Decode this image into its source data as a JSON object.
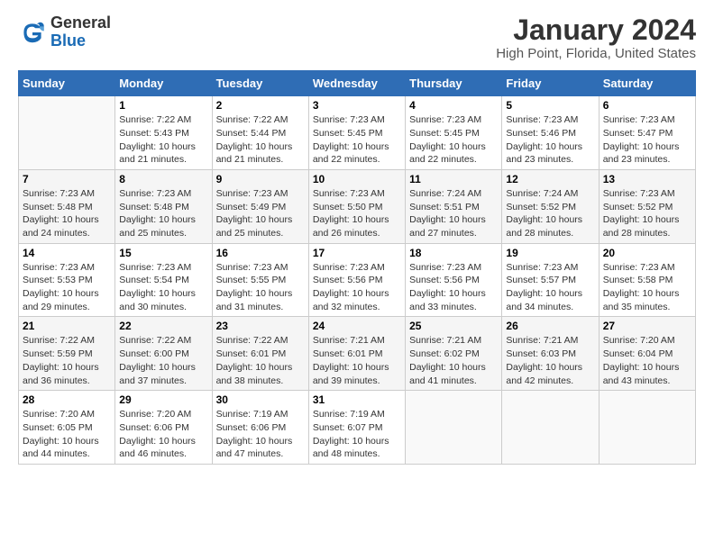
{
  "logo": {
    "general": "General",
    "blue": "Blue"
  },
  "title": "January 2024",
  "subtitle": "High Point, Florida, United States",
  "headers": [
    "Sunday",
    "Monday",
    "Tuesday",
    "Wednesday",
    "Thursday",
    "Friday",
    "Saturday"
  ],
  "weeks": [
    [
      {
        "num": "",
        "info": ""
      },
      {
        "num": "1",
        "info": "Sunrise: 7:22 AM\nSunset: 5:43 PM\nDaylight: 10 hours\nand 21 minutes."
      },
      {
        "num": "2",
        "info": "Sunrise: 7:22 AM\nSunset: 5:44 PM\nDaylight: 10 hours\nand 21 minutes."
      },
      {
        "num": "3",
        "info": "Sunrise: 7:23 AM\nSunset: 5:45 PM\nDaylight: 10 hours\nand 22 minutes."
      },
      {
        "num": "4",
        "info": "Sunrise: 7:23 AM\nSunset: 5:45 PM\nDaylight: 10 hours\nand 22 minutes."
      },
      {
        "num": "5",
        "info": "Sunrise: 7:23 AM\nSunset: 5:46 PM\nDaylight: 10 hours\nand 23 minutes."
      },
      {
        "num": "6",
        "info": "Sunrise: 7:23 AM\nSunset: 5:47 PM\nDaylight: 10 hours\nand 23 minutes."
      }
    ],
    [
      {
        "num": "7",
        "info": "Sunrise: 7:23 AM\nSunset: 5:48 PM\nDaylight: 10 hours\nand 24 minutes."
      },
      {
        "num": "8",
        "info": "Sunrise: 7:23 AM\nSunset: 5:48 PM\nDaylight: 10 hours\nand 25 minutes."
      },
      {
        "num": "9",
        "info": "Sunrise: 7:23 AM\nSunset: 5:49 PM\nDaylight: 10 hours\nand 25 minutes."
      },
      {
        "num": "10",
        "info": "Sunrise: 7:23 AM\nSunset: 5:50 PM\nDaylight: 10 hours\nand 26 minutes."
      },
      {
        "num": "11",
        "info": "Sunrise: 7:24 AM\nSunset: 5:51 PM\nDaylight: 10 hours\nand 27 minutes."
      },
      {
        "num": "12",
        "info": "Sunrise: 7:24 AM\nSunset: 5:52 PM\nDaylight: 10 hours\nand 28 minutes."
      },
      {
        "num": "13",
        "info": "Sunrise: 7:23 AM\nSunset: 5:52 PM\nDaylight: 10 hours\nand 28 minutes."
      }
    ],
    [
      {
        "num": "14",
        "info": "Sunrise: 7:23 AM\nSunset: 5:53 PM\nDaylight: 10 hours\nand 29 minutes."
      },
      {
        "num": "15",
        "info": "Sunrise: 7:23 AM\nSunset: 5:54 PM\nDaylight: 10 hours\nand 30 minutes."
      },
      {
        "num": "16",
        "info": "Sunrise: 7:23 AM\nSunset: 5:55 PM\nDaylight: 10 hours\nand 31 minutes."
      },
      {
        "num": "17",
        "info": "Sunrise: 7:23 AM\nSunset: 5:56 PM\nDaylight: 10 hours\nand 32 minutes."
      },
      {
        "num": "18",
        "info": "Sunrise: 7:23 AM\nSunset: 5:56 PM\nDaylight: 10 hours\nand 33 minutes."
      },
      {
        "num": "19",
        "info": "Sunrise: 7:23 AM\nSunset: 5:57 PM\nDaylight: 10 hours\nand 34 minutes."
      },
      {
        "num": "20",
        "info": "Sunrise: 7:23 AM\nSunset: 5:58 PM\nDaylight: 10 hours\nand 35 minutes."
      }
    ],
    [
      {
        "num": "21",
        "info": "Sunrise: 7:22 AM\nSunset: 5:59 PM\nDaylight: 10 hours\nand 36 minutes."
      },
      {
        "num": "22",
        "info": "Sunrise: 7:22 AM\nSunset: 6:00 PM\nDaylight: 10 hours\nand 37 minutes."
      },
      {
        "num": "23",
        "info": "Sunrise: 7:22 AM\nSunset: 6:01 PM\nDaylight: 10 hours\nand 38 minutes."
      },
      {
        "num": "24",
        "info": "Sunrise: 7:21 AM\nSunset: 6:01 PM\nDaylight: 10 hours\nand 39 minutes."
      },
      {
        "num": "25",
        "info": "Sunrise: 7:21 AM\nSunset: 6:02 PM\nDaylight: 10 hours\nand 41 minutes."
      },
      {
        "num": "26",
        "info": "Sunrise: 7:21 AM\nSunset: 6:03 PM\nDaylight: 10 hours\nand 42 minutes."
      },
      {
        "num": "27",
        "info": "Sunrise: 7:20 AM\nSunset: 6:04 PM\nDaylight: 10 hours\nand 43 minutes."
      }
    ],
    [
      {
        "num": "28",
        "info": "Sunrise: 7:20 AM\nSunset: 6:05 PM\nDaylight: 10 hours\nand 44 minutes."
      },
      {
        "num": "29",
        "info": "Sunrise: 7:20 AM\nSunset: 6:06 PM\nDaylight: 10 hours\nand 46 minutes."
      },
      {
        "num": "30",
        "info": "Sunrise: 7:19 AM\nSunset: 6:06 PM\nDaylight: 10 hours\nand 47 minutes."
      },
      {
        "num": "31",
        "info": "Sunrise: 7:19 AM\nSunset: 6:07 PM\nDaylight: 10 hours\nand 48 minutes."
      },
      {
        "num": "",
        "info": ""
      },
      {
        "num": "",
        "info": ""
      },
      {
        "num": "",
        "info": ""
      }
    ]
  ]
}
